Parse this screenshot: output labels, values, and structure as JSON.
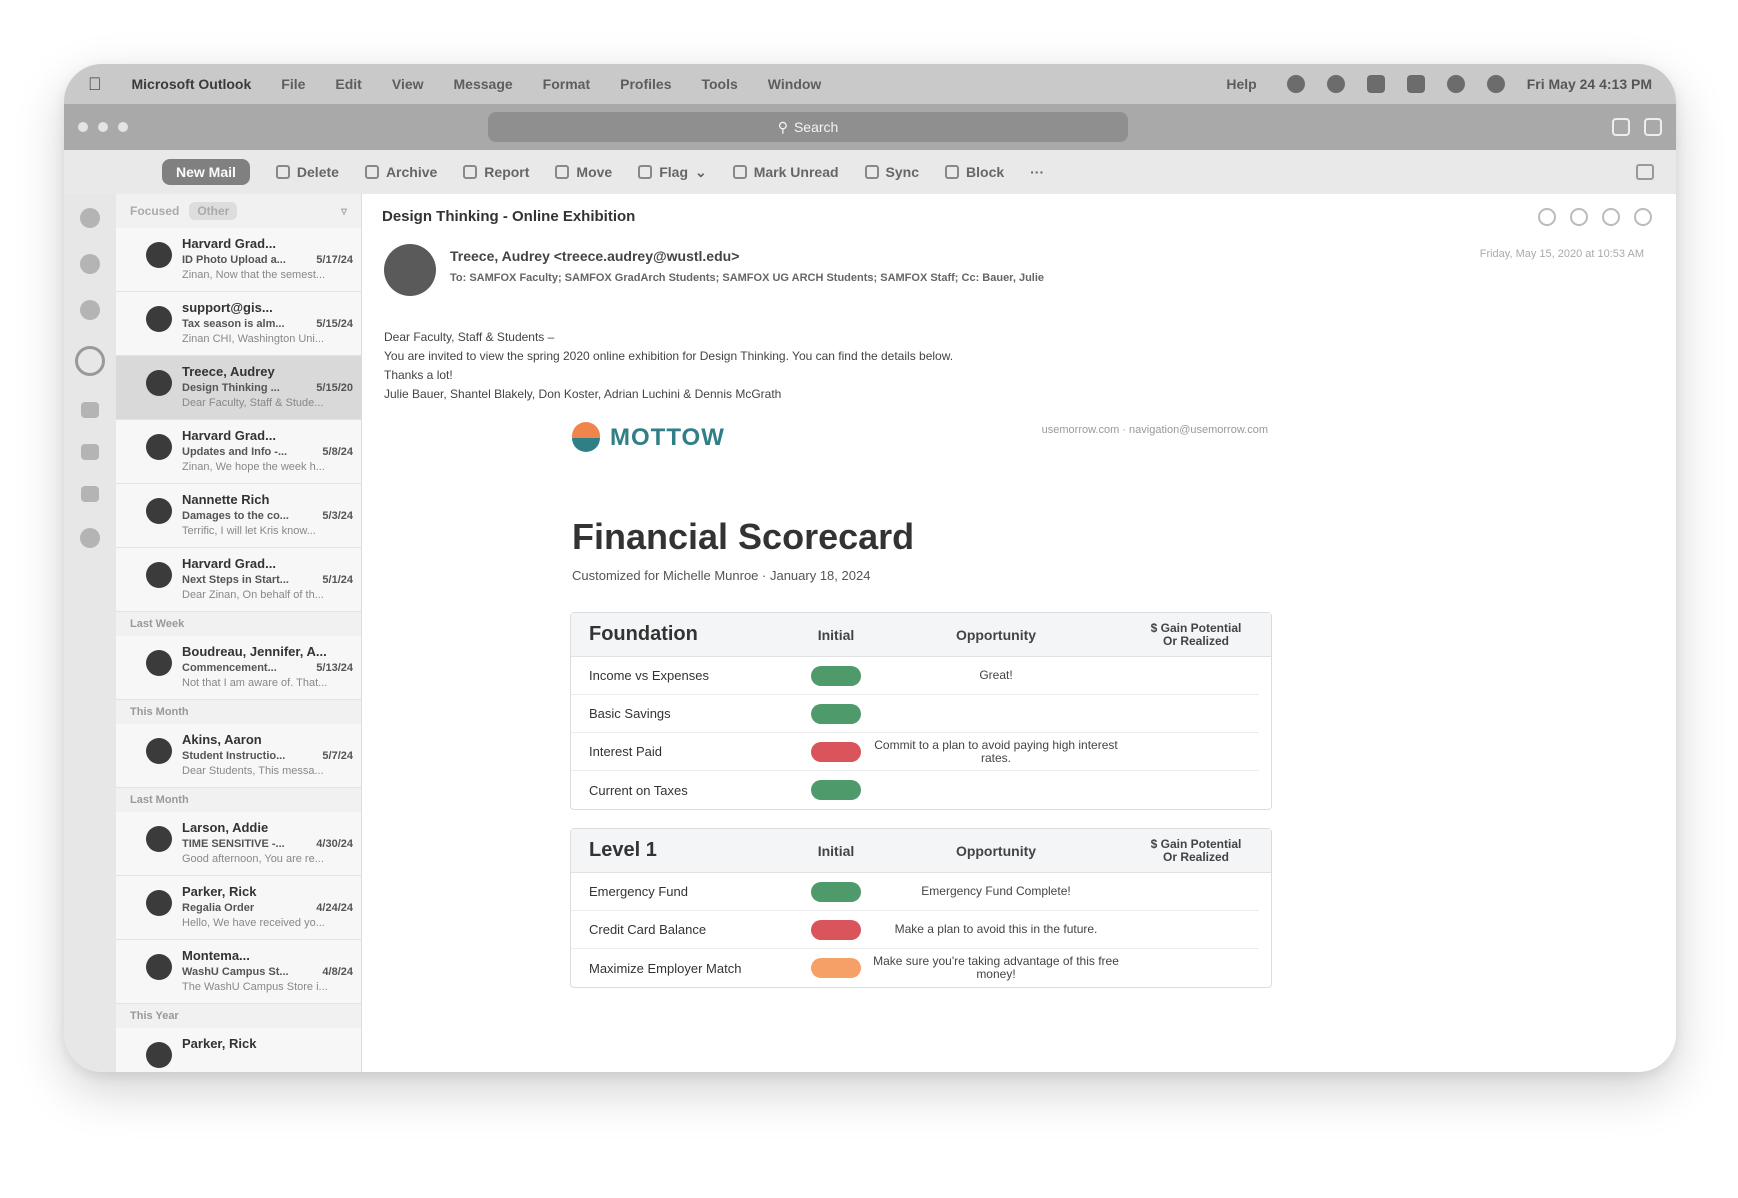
{
  "menubar": {
    "app": "Microsoft Outlook",
    "items": [
      "File",
      "Edit",
      "View",
      "Message",
      "Format",
      "Profiles",
      "Tools",
      "Window",
      "Help"
    ],
    "clock": "Fri May 24 4:13 PM"
  },
  "titlebar": {
    "search_placeholder": "Search"
  },
  "toolbar": {
    "new_mail": "New Mail",
    "buttons": [
      "Delete",
      "Archive",
      "Report",
      "Move",
      "Flag",
      "Mark Unread",
      "Sync",
      "Block",
      "···"
    ]
  },
  "list": {
    "tab_focused": "Focused",
    "tab_other": "Other",
    "items": [
      {
        "sender": "Harvard Grad...",
        "subject": "ID Photo Upload a...",
        "date": "5/17/24",
        "preview": "Zinan, Now that the semest..."
      },
      {
        "sender": "support@gis...",
        "subject": "Tax season is alm...",
        "date": "5/15/24",
        "preview": "Zinan CHI, Washington Uni..."
      },
      {
        "sender": "Treece, Audrey",
        "subject": "Design Thinking ...",
        "date": "5/15/20",
        "preview": "Dear Faculty, Staff & Stude..."
      },
      {
        "sender": "Harvard Grad...",
        "subject": "Updates and Info -...",
        "date": "5/8/24",
        "preview": "Zinan, We hope the week h..."
      },
      {
        "sender": "Nannette Rich",
        "subject": "Damages to the co...",
        "date": "5/3/24",
        "preview": "Terrific, I will let Kris know..."
      },
      {
        "sender": "Harvard Grad...",
        "subject": "Next Steps in Start...",
        "date": "5/1/24",
        "preview": "Dear Zinan, On behalf of th..."
      }
    ],
    "group_last_week": "Last Week",
    "item_last_week": {
      "sender": "Boudreau, Jennifer, A...",
      "subject": "Commencement...",
      "date": "5/13/24",
      "preview": "Not that I am aware of. That..."
    },
    "group_this_month": "This Month",
    "item_this_month": {
      "sender": "Akins, Aaron",
      "subject": "Student Instructio...",
      "date": "5/7/24",
      "preview": "Dear Students, This messa..."
    },
    "group_last_month": "Last Month",
    "items_last_month": [
      {
        "sender": "Larson, Addie",
        "subject": "TIME SENSITIVE -...",
        "date": "4/30/24",
        "preview": "Good afternoon, You are re..."
      },
      {
        "sender": "Parker, Rick",
        "subject": "Regalia Order",
        "date": "4/24/24",
        "preview": "Hello, We have received yo..."
      },
      {
        "sender": "Montema...",
        "subject": "WashU Campus St...",
        "date": "4/8/24",
        "preview": "The WashU Campus Store i..."
      }
    ],
    "group_this_year": "This Year",
    "item_this_year": {
      "sender": "Parker, Rick"
    }
  },
  "email": {
    "subject": "Design Thinking - Online Exhibition",
    "sender": "Treece, Audrey <treece.audrey@wustl.edu>",
    "to": "To:   SAMFOX Faculty;   SAMFOX GradArch Students;   SAMFOX UG ARCH Students;   SAMFOX Staff;   Cc:   Bauer, Julie",
    "date": "Friday, May 15, 2020 at 10:53 AM",
    "body": [
      "Dear Faculty, Staff & Students –",
      "You are invited to view the spring 2020 online exhibition for Design Thinking. You can find the details below.",
      "Thanks a lot!",
      "Julie Bauer, Shantel Blakely, Don Koster, Adrian Luchini & Dennis McGrath"
    ]
  },
  "scorecard": {
    "brand": "MOTTOW",
    "contact": "usemorrow.com  ·  navigation@usemorrow.com",
    "title": "Financial Scorecard",
    "subtitle": "Customized for Michelle Munroe  ·  January 18, 2024",
    "col_initial": "Initial",
    "col_opportunity": "Opportunity",
    "col_gain_1": "$ Gain Potential",
    "col_gain_2": "Or Realized",
    "colors": {
      "green": "#4e9a6a",
      "red": "#d9545b",
      "orange": "#f6a068"
    },
    "sections": [
      {
        "title": "Foundation",
        "rows": [
          {
            "name": "Income vs Expenses",
            "status": "green",
            "opportunity": "Great!"
          },
          {
            "name": "Basic Savings",
            "status": "green",
            "opportunity": ""
          },
          {
            "name": "Interest Paid",
            "status": "red",
            "opportunity": "Commit to a plan to avoid paying high interest rates."
          },
          {
            "name": "Current on Taxes",
            "status": "green",
            "opportunity": ""
          }
        ]
      },
      {
        "title": "Level 1",
        "rows": [
          {
            "name": "Emergency Fund",
            "status": "green",
            "opportunity": "Emergency Fund Complete!"
          },
          {
            "name": "Credit Card Balance",
            "status": "red",
            "opportunity": "Make a plan to avoid this in the future."
          },
          {
            "name": "Maximize Employer Match",
            "status": "orange",
            "opportunity": "Make sure you're taking advantage of this free money!"
          }
        ]
      }
    ]
  }
}
